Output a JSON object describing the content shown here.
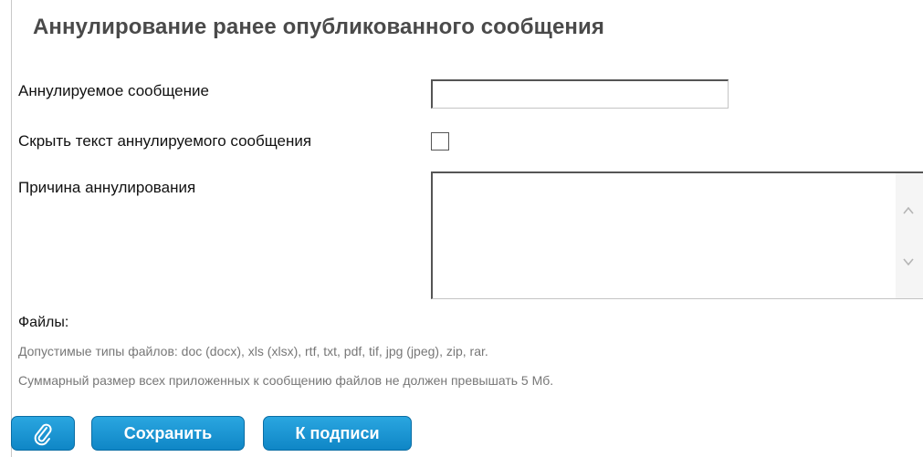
{
  "title": "Аннулирование ранее опубликованного сообщения",
  "fields": {
    "message_label": "Аннулируемое сообщение",
    "message_value": "",
    "hide_label": "Скрыть текст аннулируемого сообщения",
    "hide_checked": false,
    "reason_label": "Причина аннулирования",
    "reason_value": ""
  },
  "files": {
    "label": "Файлы:",
    "allowed_types": "Допустимые типы файлов: doc (docx), xls (xlsx), rtf, txt, pdf, tif, jpg (jpeg), zip, rar.",
    "size_limit": "Суммарный размер всех приложенных к сообщению файлов не должен превышать 5 Мб."
  },
  "buttons": {
    "attach_icon": "paperclip-icon",
    "save_label": "Сохранить",
    "sign_label": "К подписи"
  },
  "colors": {
    "button_bg": "#1a96d4",
    "title_text": "#4a4a4a",
    "hint_text": "#777777"
  }
}
